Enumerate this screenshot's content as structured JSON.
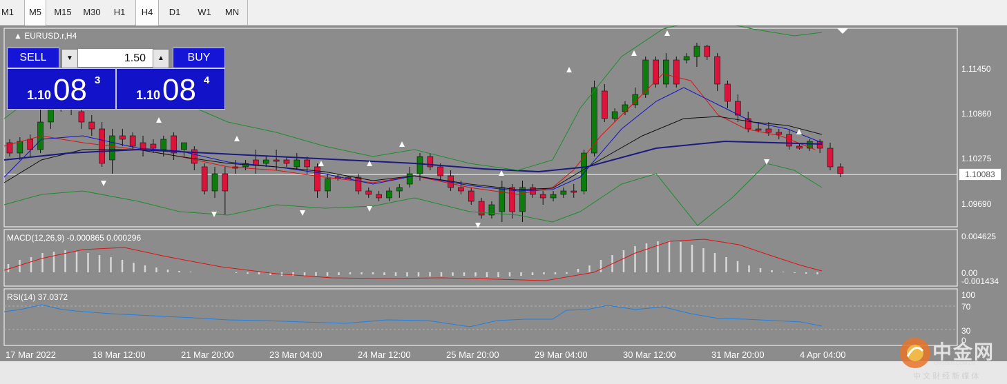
{
  "timeframes": [
    {
      "label": "M1",
      "active": false
    },
    {
      "label": "M5",
      "active": true
    },
    {
      "label": "M15",
      "active": false
    },
    {
      "label": "M30",
      "active": false
    },
    {
      "label": "H1",
      "active": false
    },
    {
      "label": "H4",
      "active": true
    },
    {
      "label": "D1",
      "active": false
    },
    {
      "label": "W1",
      "active": false
    },
    {
      "label": "MN",
      "active": false
    }
  ],
  "symbol_label": "EURUSD.r,H4",
  "trade_panel": {
    "sell_label": "SELL",
    "buy_label": "BUY",
    "volume": "1.50",
    "sell_price_small": "1.10",
    "sell_price_big": "08",
    "sell_price_sup": "3",
    "buy_price_small": "1.10",
    "buy_price_big": "08",
    "buy_price_sup": "4"
  },
  "price_axis": [
    "1.11450",
    "1.10860",
    "1.10275",
    "1.09690"
  ],
  "current_price": "1.10083",
  "macd": {
    "label": "MACD(12,26,9) -0.000865 0.000296",
    "axis": [
      "0.004625",
      "0.00",
      "-0.001434"
    ]
  },
  "rsi": {
    "label": "RSI(14) 37.0372",
    "axis": [
      "100",
      "70",
      "30",
      "0"
    ]
  },
  "date_axis": [
    "17 Mar 2022",
    "18 Mar 12:00",
    "21 Mar 20:00",
    "23 Mar 04:00",
    "24 Mar 12:00",
    "25 Mar 20:00",
    "29 Mar 04:00",
    "30 Mar 12:00",
    "31 Mar 20:00",
    "4 Apr 04:00"
  ],
  "colors": {
    "background": "#8c8c8c",
    "bull_candle": "#0b7d0b",
    "bear_candle": "#dc143c",
    "ma_fast": "#e01010",
    "ma_mid": "#1010c8",
    "ma_slow": "#101010",
    "ma_long": "#1a1a80",
    "bollinger": "#1c8c2c",
    "macd_signal": "#e01010",
    "rsi_line": "#1e7fe0",
    "trade_button": "#1515d8"
  },
  "watermark": {
    "brand": "中金网",
    "domain": "CNGOLD.COM.CN",
    "slogan": "中 文 财 经 新 媒 体"
  }
}
